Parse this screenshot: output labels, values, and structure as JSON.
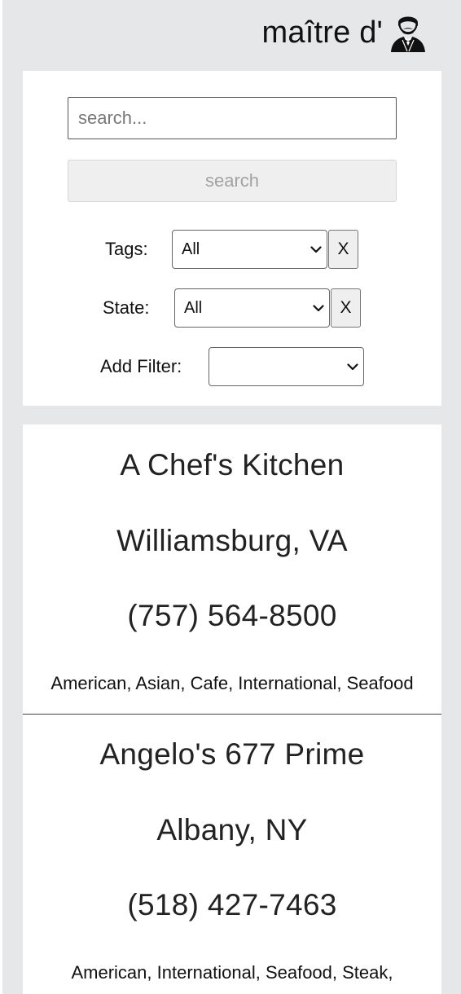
{
  "header": {
    "brand_name": "maître d'",
    "brand_icon": "waiter-icon"
  },
  "filters": {
    "search_placeholder": "search...",
    "search_value": "",
    "search_button_label": "search",
    "tags": {
      "label": "Tags:",
      "selected": "All",
      "clear_label": "X"
    },
    "state": {
      "label": "State:",
      "selected": "All",
      "clear_label": "X"
    },
    "add_filter": {
      "label": "Add Filter:",
      "selected": ""
    }
  },
  "restaurants": [
    {
      "name": "A Chef's Kitchen",
      "location": "Williamsburg, VA",
      "phone": "(757) 564-8500",
      "tags": "American, Asian, Cafe, International, Seafood"
    },
    {
      "name": "Angelo's 677 Prime",
      "location": "Albany, NY",
      "phone": "(518) 427-7463",
      "tags": "American, International, Seafood, Steak,"
    }
  ],
  "colors": {
    "page_background": "#e6e7e9",
    "panel_background": "#ffffff",
    "disabled_button_background": "#efefef",
    "disabled_button_text": "#a2a2a2"
  }
}
